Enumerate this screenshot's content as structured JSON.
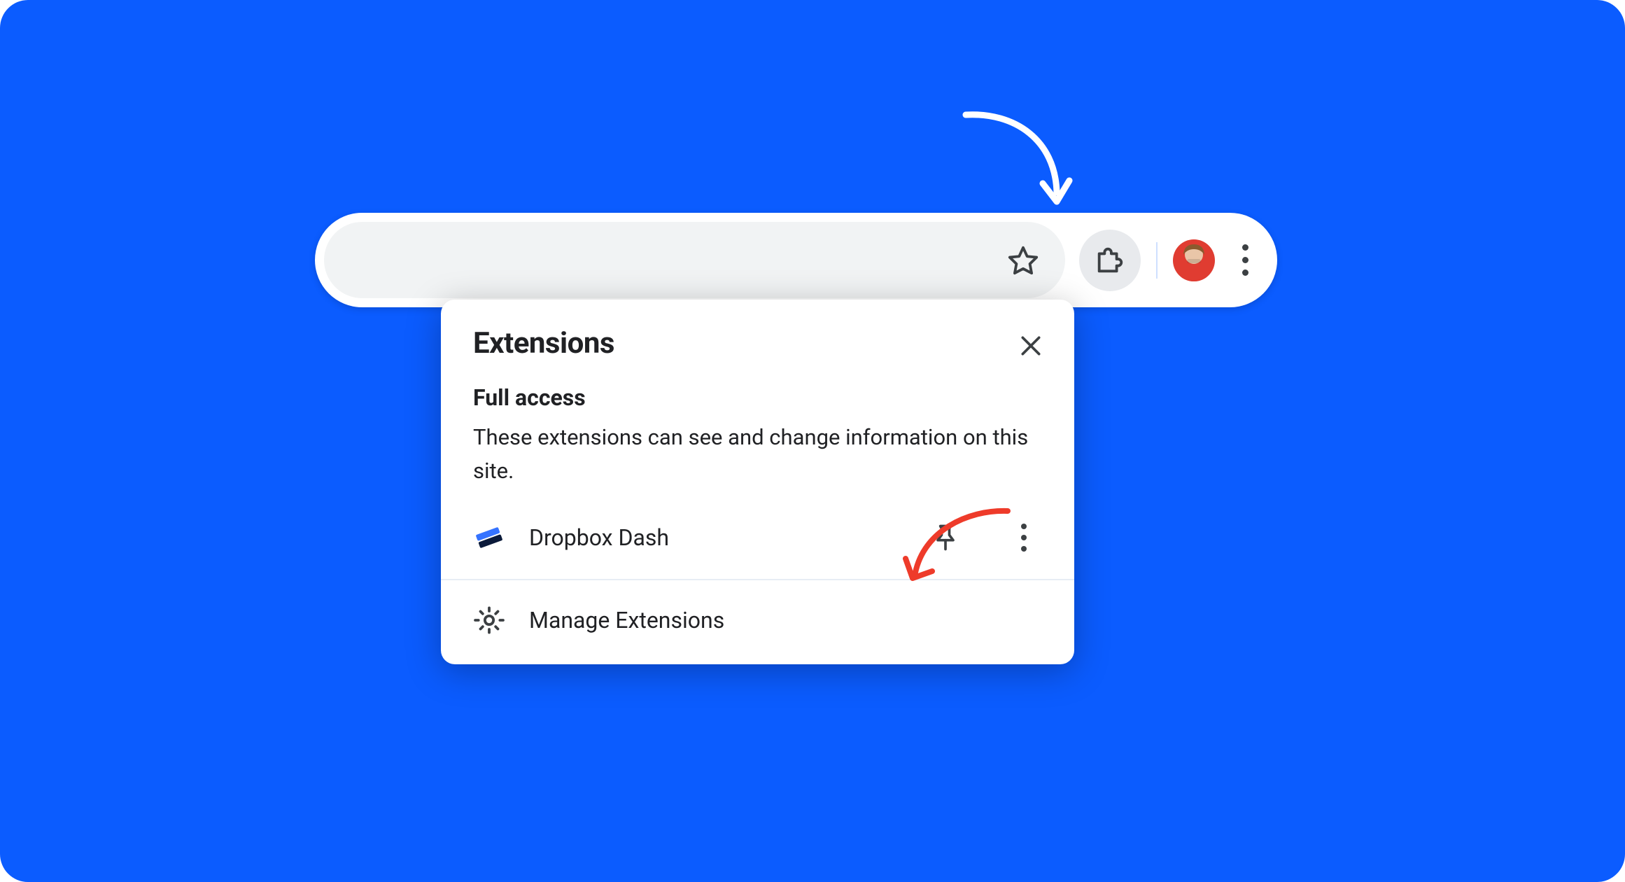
{
  "toolbar": {
    "star_icon": "star-icon",
    "extensions_icon": "extensions-puzzle-icon",
    "profile_icon": "profile-avatar",
    "menu_icon": "more-vertical-icon"
  },
  "popover": {
    "title": "Extensions",
    "close_label": "Close",
    "section_title": "Full access",
    "section_description": "These extensions can see and change information on this site.",
    "extension": {
      "name": "Dropbox Dash",
      "icon": "dropbox-dash-icon",
      "pin_label": "Pin",
      "more_label": "More"
    },
    "manage_label": "Manage Extensions"
  },
  "colors": {
    "background": "#0b5cff",
    "chrome_surface": "#ffffff",
    "omnibox": "#f1f3f4",
    "icon": "#3c4043",
    "annotation_red": "#ee3b2a"
  }
}
